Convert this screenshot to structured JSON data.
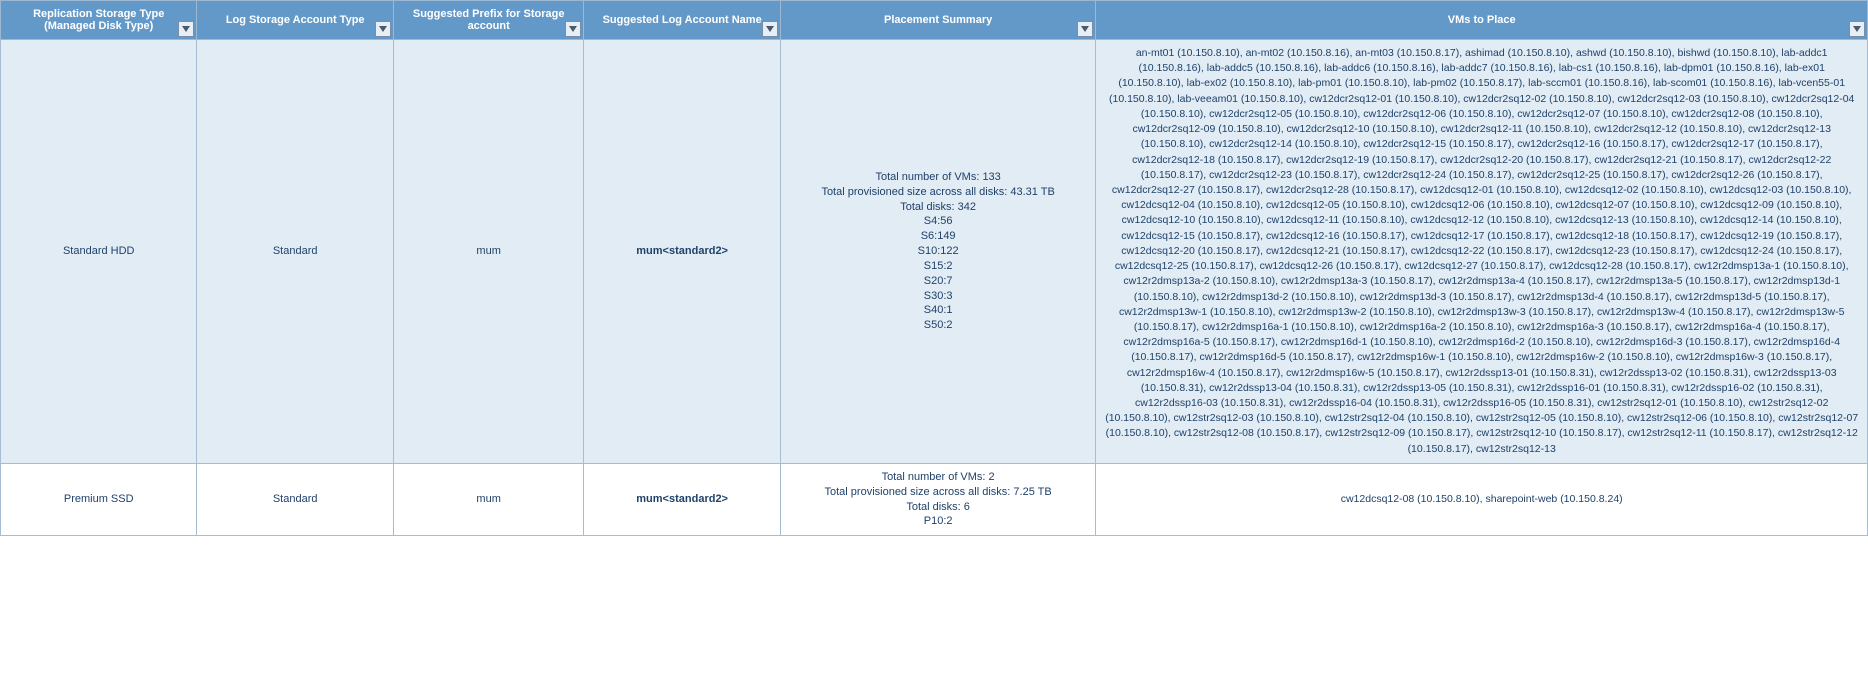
{
  "headers": [
    "Replication Storage Type\n(Managed Disk Type)",
    "Log Storage Account Type",
    "Suggested Prefix for Storage\naccount",
    "Suggested Log Account  Name",
    "Placement Summary",
    "VMs to Place"
  ],
  "rows": [
    {
      "replication_type": "Standard HDD",
      "log_type": "Standard",
      "prefix": "mum",
      "log_account": "mum<standard2>",
      "summary": "Total number of VMs: 133\nTotal provisioned size across all disks: 43.31 TB\nTotal disks: 342\nS4:56\nS6:149\nS10:122\nS15:2\nS20:7\nS30:3\nS40:1\nS50:2",
      "vms": "an-mt01 (10.150.8.10), an-mt02 (10.150.8.16), an-mt03 (10.150.8.17), ashimad (10.150.8.10), ashwd (10.150.8.10), bishwd (10.150.8.10), lab-addc1 (10.150.8.16), lab-addc5 (10.150.8.16), lab-addc6 (10.150.8.16), lab-addc7 (10.150.8.16), lab-cs1 (10.150.8.16), lab-dpm01 (10.150.8.16), lab-ex01 (10.150.8.10), lab-ex02 (10.150.8.10), lab-pm01 (10.150.8.10), lab-pm02 (10.150.8.17), lab-sccm01 (10.150.8.16), lab-scom01 (10.150.8.16), lab-vcen55-01 (10.150.8.10), lab-veeam01 (10.150.8.10), cw12dcr2sq12-01 (10.150.8.10), cw12dcr2sq12-02 (10.150.8.10), cw12dcr2sq12-03 (10.150.8.10), cw12dcr2sq12-04 (10.150.8.10), cw12dcr2sq12-05 (10.150.8.10), cw12dcr2sq12-06 (10.150.8.10), cw12dcr2sq12-07 (10.150.8.10), cw12dcr2sq12-08 (10.150.8.10), cw12dcr2sq12-09 (10.150.8.10), cw12dcr2sq12-10 (10.150.8.10), cw12dcr2sq12-11 (10.150.8.10), cw12dcr2sq12-12 (10.150.8.10), cw12dcr2sq12-13 (10.150.8.10), cw12dcr2sq12-14 (10.150.8.10), cw12dcr2sq12-15 (10.150.8.17), cw12dcr2sq12-16 (10.150.8.17), cw12dcr2sq12-17 (10.150.8.17), cw12dcr2sq12-18 (10.150.8.17), cw12dcr2sq12-19 (10.150.8.17), cw12dcr2sq12-20 (10.150.8.17), cw12dcr2sq12-21 (10.150.8.17), cw12dcr2sq12-22 (10.150.8.17), cw12dcr2sq12-23 (10.150.8.17), cw12dcr2sq12-24 (10.150.8.17), cw12dcr2sq12-25 (10.150.8.17), cw12dcr2sq12-26 (10.150.8.17), cw12dcr2sq12-27 (10.150.8.17), cw12dcr2sq12-28 (10.150.8.17), cw12dcsq12-01 (10.150.8.10), cw12dcsq12-02 (10.150.8.10), cw12dcsq12-03 (10.150.8.10), cw12dcsq12-04 (10.150.8.10), cw12dcsq12-05 (10.150.8.10), cw12dcsq12-06 (10.150.8.10), cw12dcsq12-07 (10.150.8.10), cw12dcsq12-09 (10.150.8.10), cw12dcsq12-10 (10.150.8.10), cw12dcsq12-11 (10.150.8.10), cw12dcsq12-12 (10.150.8.10), cw12dcsq12-13 (10.150.8.10), cw12dcsq12-14 (10.150.8.10), cw12dcsq12-15 (10.150.8.17), cw12dcsq12-16 (10.150.8.17), cw12dcsq12-17 (10.150.8.17), cw12dcsq12-18 (10.150.8.17), cw12dcsq12-19 (10.150.8.17), cw12dcsq12-20 (10.150.8.17), cw12dcsq12-21 (10.150.8.17), cw12dcsq12-22 (10.150.8.17), cw12dcsq12-23 (10.150.8.17), cw12dcsq12-24 (10.150.8.17), cw12dcsq12-25 (10.150.8.17), cw12dcsq12-26 (10.150.8.17), cw12dcsq12-27 (10.150.8.17), cw12dcsq12-28 (10.150.8.17), cw12r2dmsp13a-1 (10.150.8.10), cw12r2dmsp13a-2 (10.150.8.10), cw12r2dmsp13a-3 (10.150.8.17), cw12r2dmsp13a-4 (10.150.8.17), cw12r2dmsp13a-5 (10.150.8.17), cw12r2dmsp13d-1 (10.150.8.10), cw12r2dmsp13d-2 (10.150.8.10), cw12r2dmsp13d-3 (10.150.8.17), cw12r2dmsp13d-4 (10.150.8.17), cw12r2dmsp13d-5 (10.150.8.17), cw12r2dmsp13w-1 (10.150.8.10), cw12r2dmsp13w-2 (10.150.8.10), cw12r2dmsp13w-3 (10.150.8.17), cw12r2dmsp13w-4 (10.150.8.17), cw12r2dmsp13w-5 (10.150.8.17), cw12r2dmsp16a-1 (10.150.8.10), cw12r2dmsp16a-2 (10.150.8.10), cw12r2dmsp16a-3 (10.150.8.17), cw12r2dmsp16a-4 (10.150.8.17), cw12r2dmsp16a-5 (10.150.8.17), cw12r2dmsp16d-1 (10.150.8.10), cw12r2dmsp16d-2 (10.150.8.10), cw12r2dmsp16d-3 (10.150.8.17), cw12r2dmsp16d-4 (10.150.8.17), cw12r2dmsp16d-5 (10.150.8.17), cw12r2dmsp16w-1 (10.150.8.10), cw12r2dmsp16w-2 (10.150.8.10), cw12r2dmsp16w-3 (10.150.8.17), cw12r2dmsp16w-4 (10.150.8.17), cw12r2dmsp16w-5 (10.150.8.17), cw12r2dssp13-01 (10.150.8.31), cw12r2dssp13-02 (10.150.8.31), cw12r2dssp13-03 (10.150.8.31), cw12r2dssp13-04 (10.150.8.31), cw12r2dssp13-05 (10.150.8.31), cw12r2dssp16-01 (10.150.8.31), cw12r2dssp16-02 (10.150.8.31), cw12r2dssp16-03 (10.150.8.31), cw12r2dssp16-04 (10.150.8.31), cw12r2dssp16-05 (10.150.8.31), cw12str2sq12-01 (10.150.8.10), cw12str2sq12-02 (10.150.8.10), cw12str2sq12-03 (10.150.8.10), cw12str2sq12-04 (10.150.8.10), cw12str2sq12-05 (10.150.8.10), cw12str2sq12-06 (10.150.8.10), cw12str2sq12-07 (10.150.8.10), cw12str2sq12-08 (10.150.8.17), cw12str2sq12-09 (10.150.8.17), cw12str2sq12-10 (10.150.8.17), cw12str2sq12-11 (10.150.8.17), cw12str2sq12-12 (10.150.8.17), cw12str2sq12-13"
    },
    {
      "replication_type": "Premium SSD",
      "log_type": "Standard",
      "prefix": "mum",
      "log_account": "mum<standard2>",
      "summary": "Total number of VMs: 2\nTotal provisioned size across all disks: 7.25 TB\nTotal disks: 6\nP10:2",
      "vms": "cw12dcsq12-08 (10.150.8.10), sharepoint-web (10.150.8.24)"
    }
  ]
}
